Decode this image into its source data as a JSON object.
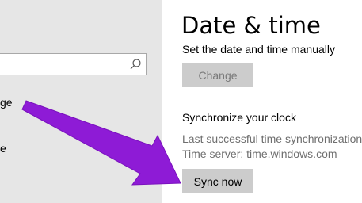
{
  "sidebar": {
    "search": {
      "value": "",
      "icon": "search-icon"
    },
    "nav_fragments": [
      "ge",
      "e"
    ]
  },
  "main": {
    "title": "Date & time",
    "manual_label": "Set the date and time manually",
    "change_button": "Change",
    "sync_heading": "Synchronize your clock",
    "last_sync": "Last successful time synchronization:",
    "time_server": "Time server: time.windows.com",
    "sync_button": "Sync now"
  },
  "annotation": {
    "arrow_color": "#8e1bd6"
  }
}
